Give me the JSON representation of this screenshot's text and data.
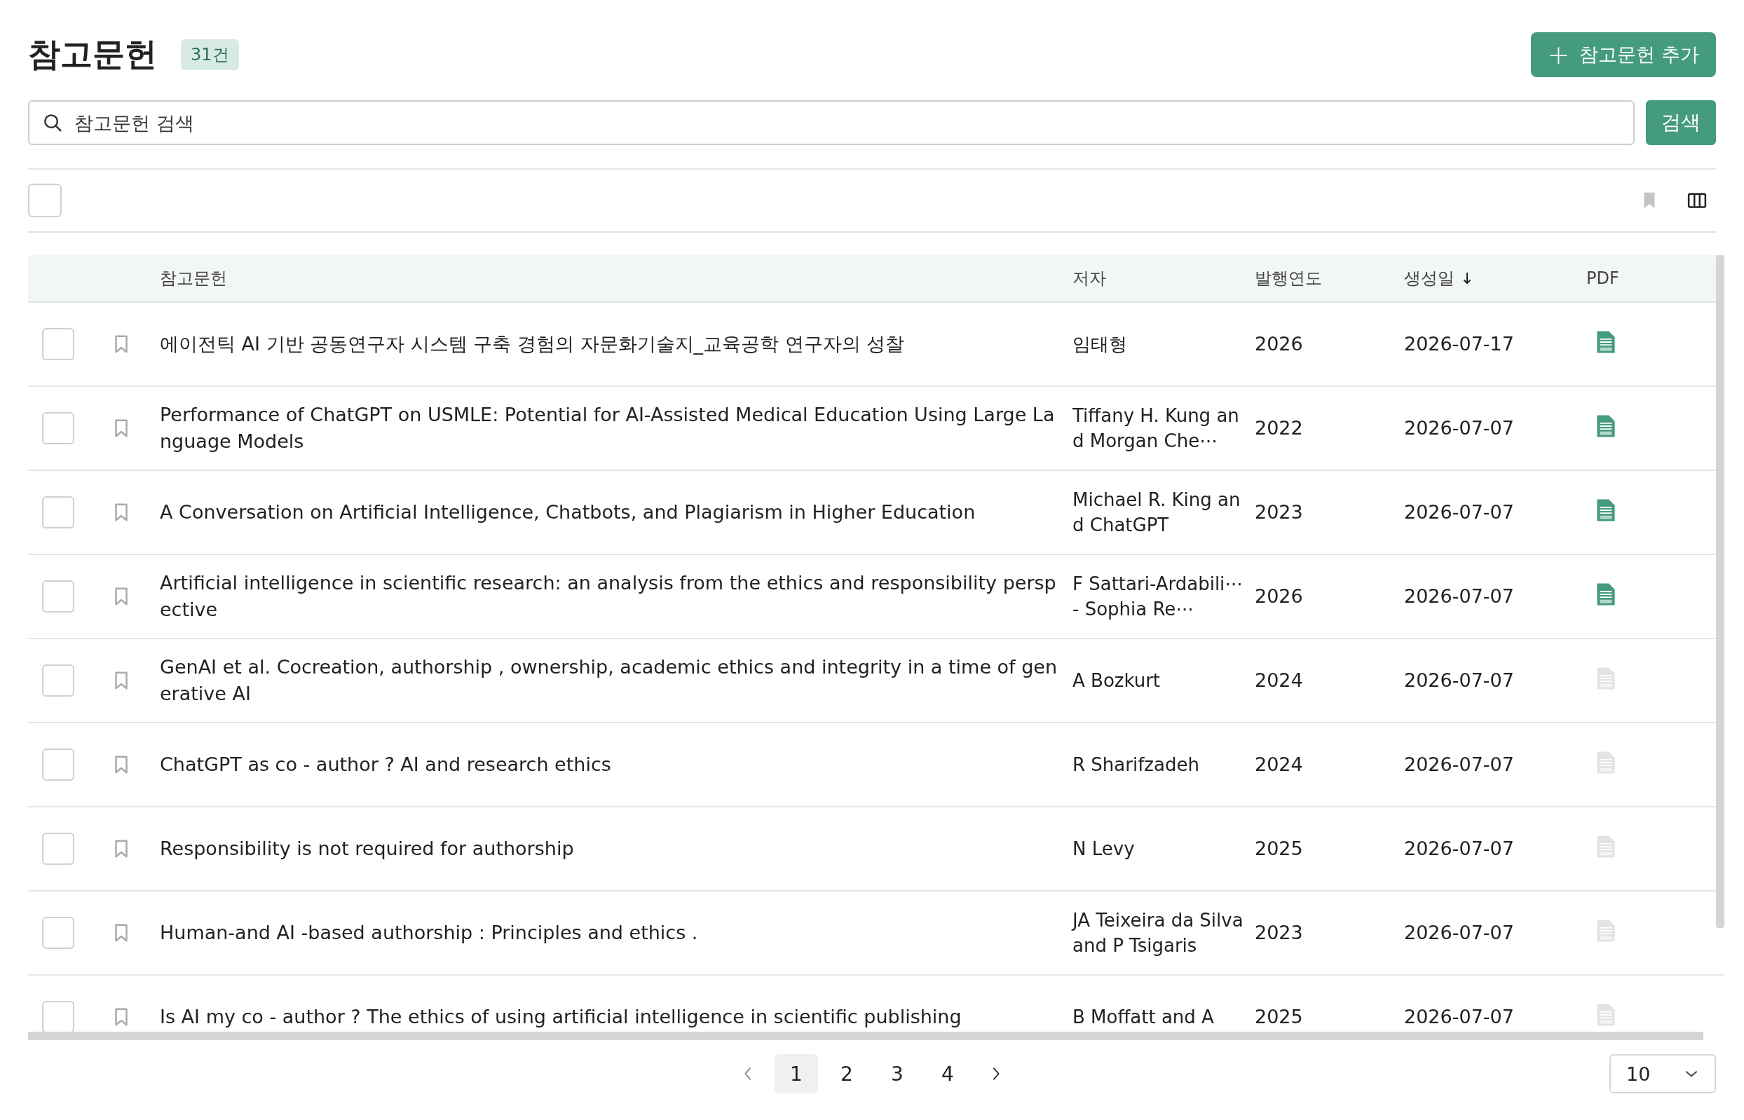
{
  "header": {
    "title": "참고문헌",
    "count_badge": "31건",
    "add_button": {
      "icon": "+",
      "label": "참고문헌 추가"
    }
  },
  "search": {
    "placeholder": "참고문헌 검색",
    "button": "검색"
  },
  "toolbar": {
    "select_all_checked": false
  },
  "table": {
    "columns": [
      {
        "label": "참고문헌",
        "sorted_desc": false
      },
      {
        "label": "저자",
        "sorted_desc": false
      },
      {
        "label": "발행연도",
        "sorted_desc": false
      },
      {
        "label": "생성일",
        "sorted_desc": true
      },
      {
        "label": "PDF",
        "sorted_desc": false
      }
    ],
    "rows": [
      {
        "checked": false,
        "bookmarked": false,
        "title": "에이전틱 AI 기반 공동연구자 시스템 구축 경험의 자문화기술지_교육공학 연구자의 성찰",
        "author": "임태형",
        "year": "2026",
        "created": "2026-07-17",
        "has_pdf": true
      },
      {
        "checked": false,
        "bookmarked": false,
        "title": "Performance of ChatGPT on USMLE: Potential for AI-Assisted Medical Education Using Large Language Models",
        "author": "Tiffany H. Kung and Morgan Che⋯",
        "year": "2022",
        "created": "2026-07-07",
        "has_pdf": true
      },
      {
        "checked": false,
        "bookmarked": false,
        "title": "A Conversation on Artificial Intelligence, Chatbots, and Plagiarism in Higher Education",
        "author": "Michael R. King and ChatGPT",
        "year": "2023",
        "created": "2026-07-07",
        "has_pdf": true
      },
      {
        "checked": false,
        "bookmarked": false,
        "title": "Artificial intelligence in scientific research: an analysis from the ethics and responsibility perspective",
        "author": "F Sattari-Ardabili⋯ - Sophia Re⋯",
        "year": "2026",
        "created": "2026-07-07",
        "has_pdf": true
      },
      {
        "checked": false,
        "bookmarked": false,
        "title": "GenAI et al. Cocreation, authorship , ownership, academic ethics and integrity in a time of generative AI",
        "author": "A Bozkurt",
        "year": "2024",
        "created": "2026-07-07",
        "has_pdf": false
      },
      {
        "checked": false,
        "bookmarked": false,
        "title": "ChatGPT as co - author ? AI and research ethics",
        "author": "R Sharifzadeh",
        "year": "2024",
        "created": "2026-07-07",
        "has_pdf": false
      },
      {
        "checked": false,
        "bookmarked": false,
        "title": "Responsibility is not required for authorship",
        "author": "N Levy",
        "year": "2025",
        "created": "2026-07-07",
        "has_pdf": false
      },
      {
        "checked": false,
        "bookmarked": false,
        "title": "Human-and AI -based authorship : Principles and ethics .",
        "author": "JA Teixeira da Silva and P Tsigaris",
        "year": "2023",
        "created": "2026-07-07",
        "has_pdf": false
      },
      {
        "checked": false,
        "bookmarked": false,
        "title": "Is AI my co - author ? The ethics of using artificial intelligence in scientific publishing",
        "author": "B Moffatt and A",
        "year": "2025",
        "created": "2026-07-07",
        "has_pdf": false
      }
    ]
  },
  "pagination": {
    "pages": [
      {
        "label": "1",
        "selected": true
      },
      {
        "label": "2",
        "selected": false
      },
      {
        "label": "3",
        "selected": false
      },
      {
        "label": "4",
        "selected": false
      }
    ],
    "page_size": "10"
  }
}
